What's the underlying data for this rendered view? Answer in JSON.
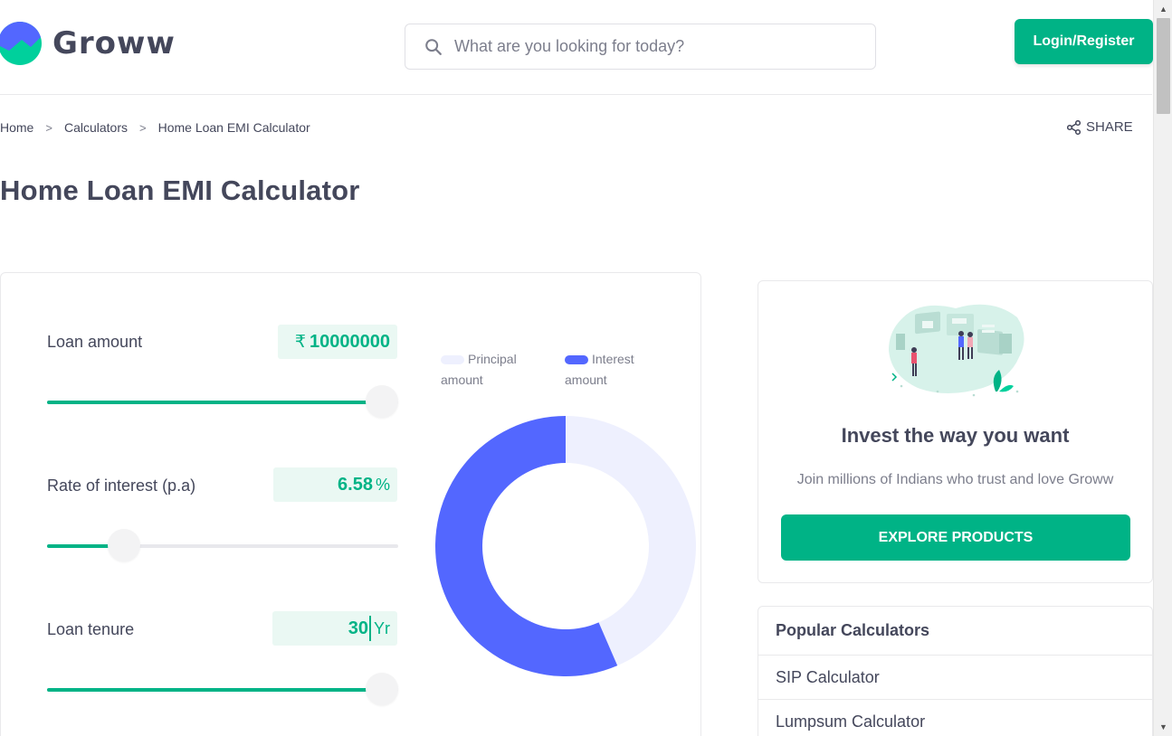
{
  "brand": {
    "name": "Groww",
    "accent": "#00b386",
    "interest_color": "#5367ff",
    "principal_color": "#eef0fe"
  },
  "search": {
    "placeholder": "What are you looking for today?",
    "icon": "search-icon"
  },
  "header": {
    "login_label": "Login/Register"
  },
  "breadcrumb": {
    "items": [
      "Home",
      "Calculators",
      "Home Loan EMI Calculator"
    ],
    "separator": ">"
  },
  "share": {
    "label": "SHARE",
    "icon": "share-icon"
  },
  "page": {
    "title": "Home Loan EMI Calculator"
  },
  "calculator": {
    "loan_amount": {
      "label": "Loan amount",
      "currency": "₹",
      "value": "10000000",
      "slider_fraction": 1.0
    },
    "interest_rate": {
      "label": "Rate of interest (p.a)",
      "value": "6.58",
      "unit": "%",
      "slider_fraction": 0.22
    },
    "tenure": {
      "label": "Loan tenure",
      "value": "30",
      "unit": "Yr",
      "slider_fraction": 1.0
    }
  },
  "chart_data": {
    "type": "pie",
    "labels": [
      "Principal amount",
      "Interest amount"
    ],
    "values": [
      43.5,
      56.5
    ],
    "colors": [
      "#eef0fe",
      "#5367ff"
    ],
    "legend_position": "top"
  },
  "promo": {
    "title": "Invest the way you want",
    "subtitle": "Join millions of Indians who trust and love Groww",
    "button_label": "EXPLORE PRODUCTS"
  },
  "popular_calculators": {
    "title": "Popular Calculators",
    "items": [
      "SIP Calculator",
      "Lumpsum Calculator"
    ]
  }
}
